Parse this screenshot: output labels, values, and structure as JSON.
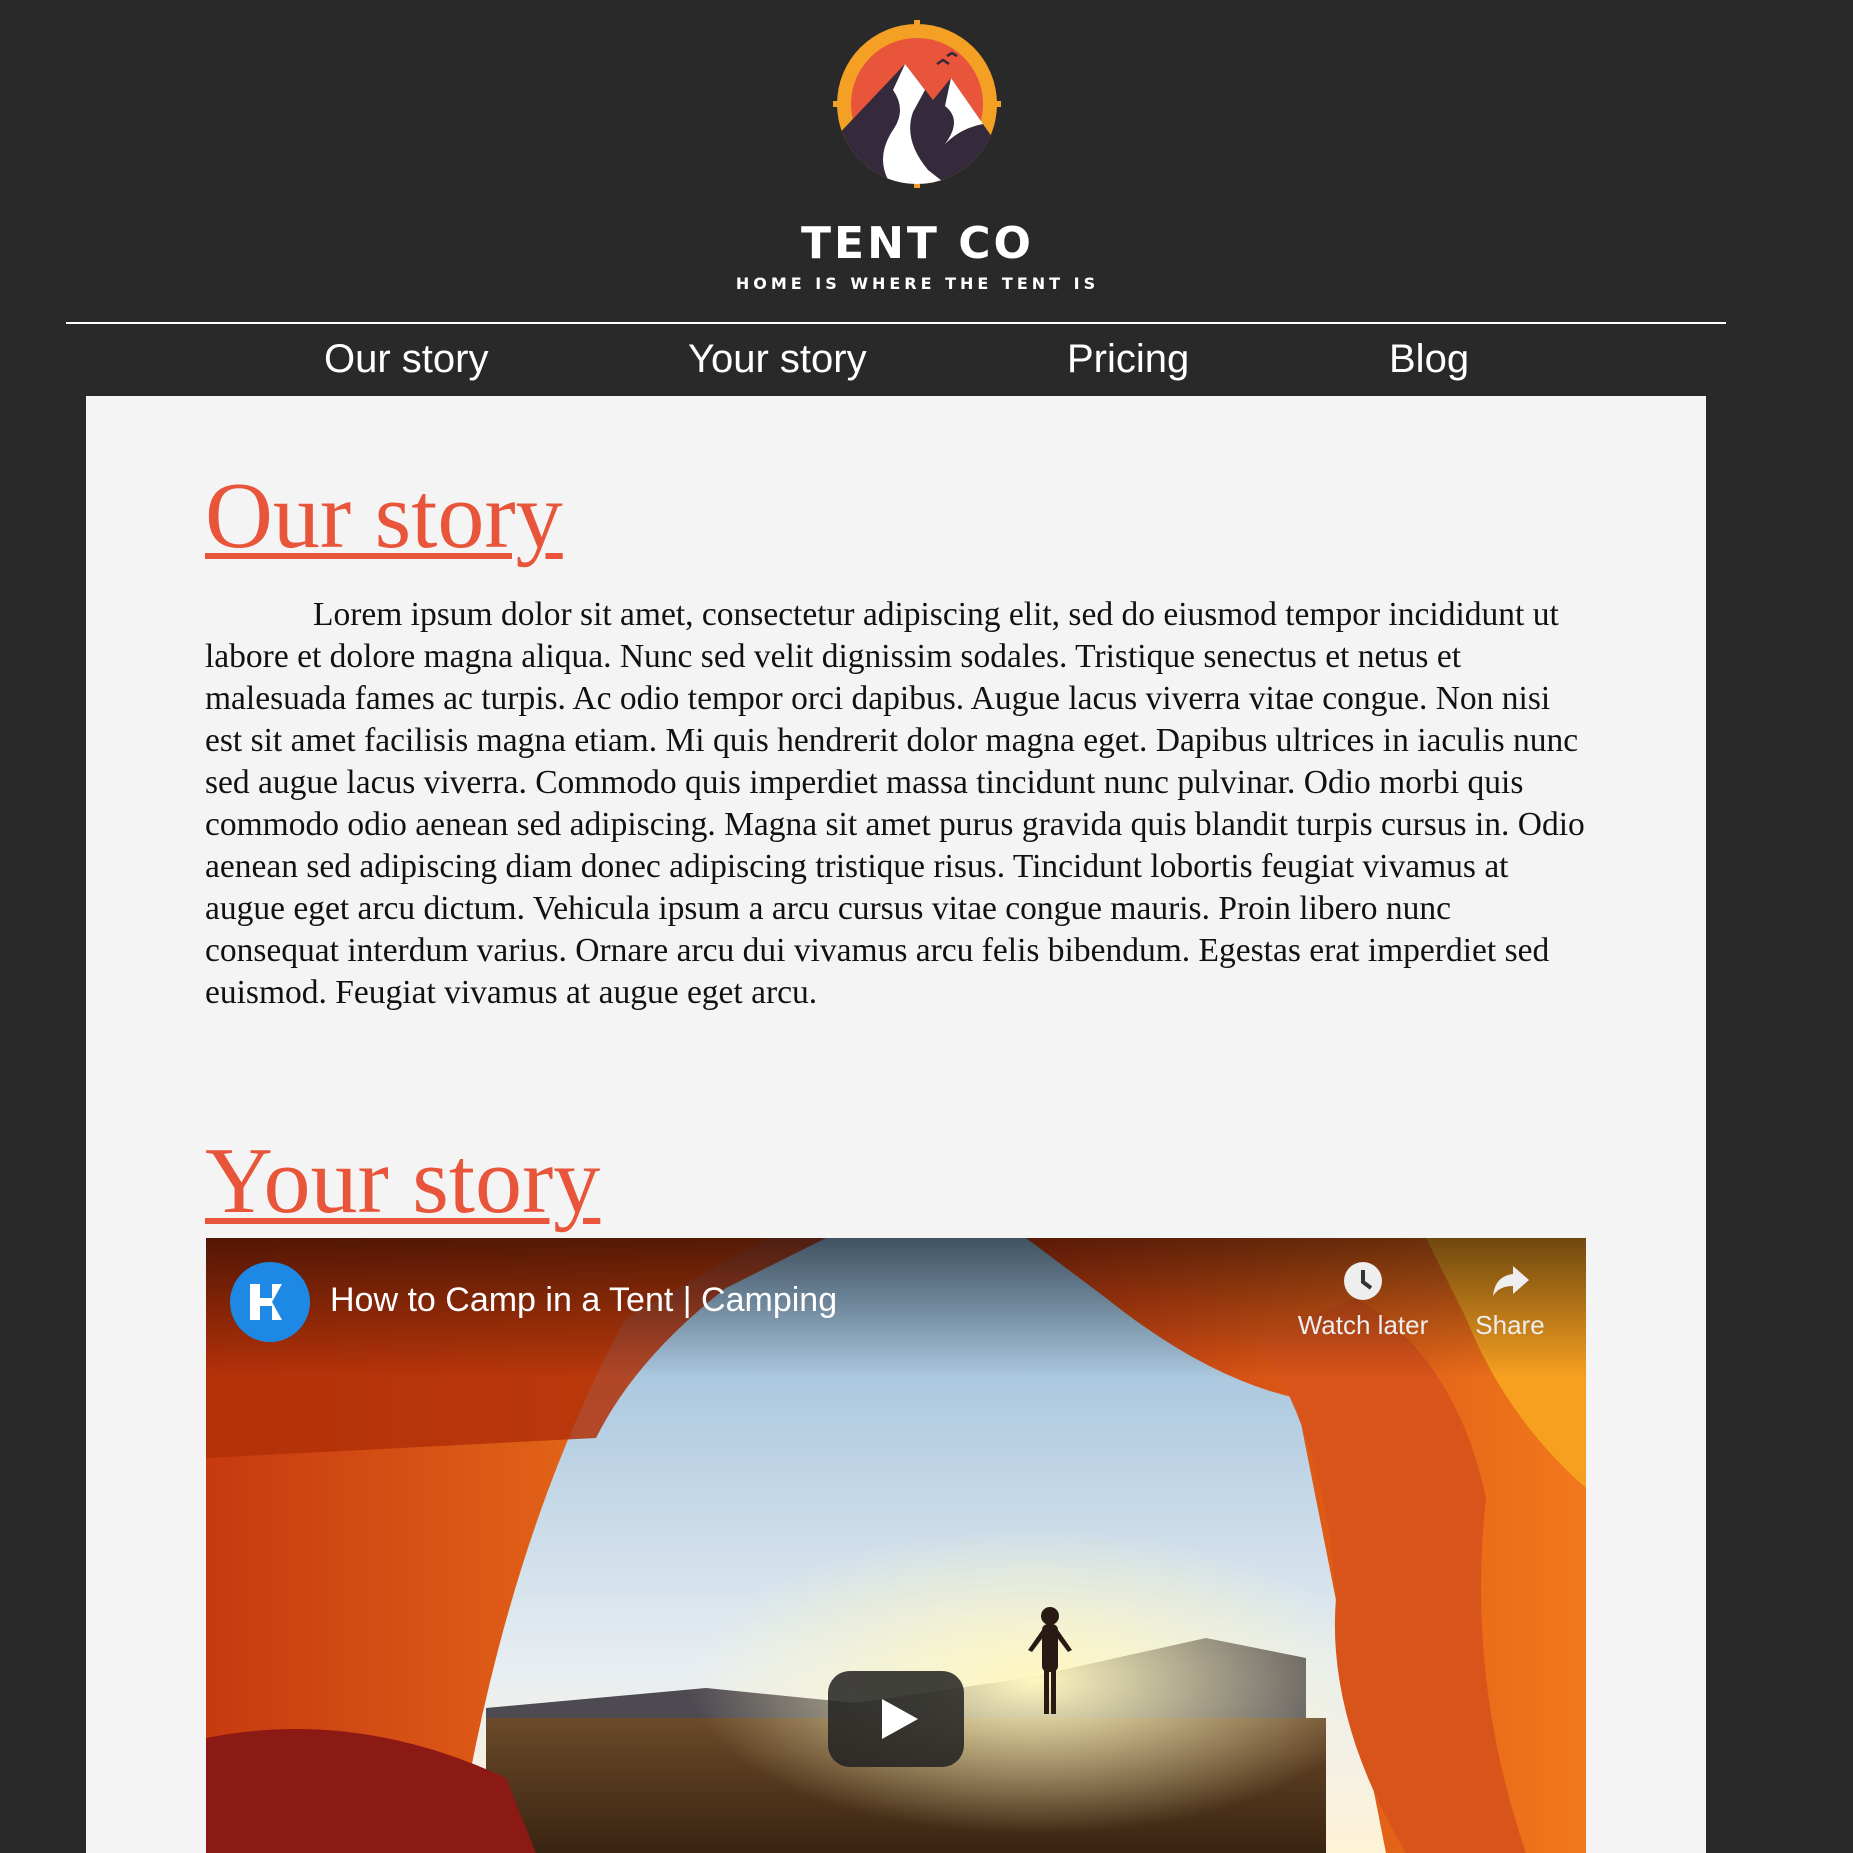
{
  "brand": {
    "name": "TENT CO",
    "tagline": "HOME IS WHERE THE TENT IS",
    "logo_icon": "mountain-sun-logo-icon"
  },
  "nav": {
    "items": [
      {
        "label": "Our story"
      },
      {
        "label": "Your story"
      },
      {
        "label": "Pricing"
      },
      {
        "label": "Blog"
      }
    ]
  },
  "sections": {
    "our_story": {
      "title": "Our story",
      "body": "Lorem ipsum dolor sit amet, consectetur adipiscing elit, sed do eiusmod tempor incididunt ut labore et dolore magna aliqua. Nunc sed velit dignissim sodales. Tristique senectus et netus et malesuada fames ac turpis. Ac odio tempor orci dapibus. Augue lacus viverra vitae congue. Non nisi est sit amet facilisis magna etiam. Mi quis hendrerit dolor magna eget. Dapibus ultrices in iaculis nunc sed augue lacus viverra. Commodo quis imperdiet massa tincidunt nunc pulvinar. Odio morbi quis commodo odio aenean sed adipiscing. Magna sit amet purus gravida quis blandit turpis cursus in. Odio aenean sed adipiscing diam donec adipiscing tristique risus. Tincidunt lobortis feugiat vivamus at augue eget arcu dictum. Vehicula ipsum a arcu cursus vitae congue mauris. Proin libero nunc consequat interdum varius. Ornare arcu dui vivamus arcu felis bibendum. Egestas erat imperdiet sed euismod. Feugiat vivamus at augue eget arcu."
    },
    "your_story": {
      "title": "Your story"
    }
  },
  "video": {
    "title": "How to Camp in a Tent | Camping",
    "watch_later_label": "Watch later",
    "share_label": "Share",
    "channel_icon": "channel-logo-icon",
    "play_icon": "play-icon"
  },
  "colors": {
    "background": "#292929",
    "content_background": "#f4f4f4",
    "accent": "#e8553a",
    "text": "#111111"
  }
}
